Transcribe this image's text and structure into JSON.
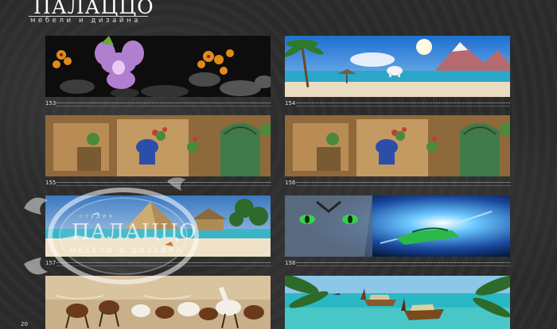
{
  "brand": {
    "name": "ПАЛАЦЦО",
    "tagline": "мебели и дизайна"
  },
  "watermark": {
    "top": "студия",
    "name": "ПАЛАЦЦО",
    "tagline": "МЕБЕЛИ И ДИЗАЙНА"
  },
  "page_number": "20",
  "items": [
    {
      "number": "153",
      "image": "orchid-flowers-on-black-stones"
    },
    {
      "number": "154",
      "image": "tropical-beach-with-polar-bear-and-mountains"
    },
    {
      "number": "155",
      "image": "old-mediterranean-courtyard-with-green-door"
    },
    {
      "number": "156",
      "image": "old-mediterranean-courtyard-with-green-door"
    },
    {
      "number": "157",
      "image": "beach-with-pyramid-and-hut"
    },
    {
      "number": "158",
      "image": "tiger-eyes-and-sports-car-light-burst"
    },
    {
      "number": "",
      "image": "galloping-white-horses"
    },
    {
      "number": "",
      "image": "tropical-lagoon-with-longtail-boats"
    }
  ]
}
